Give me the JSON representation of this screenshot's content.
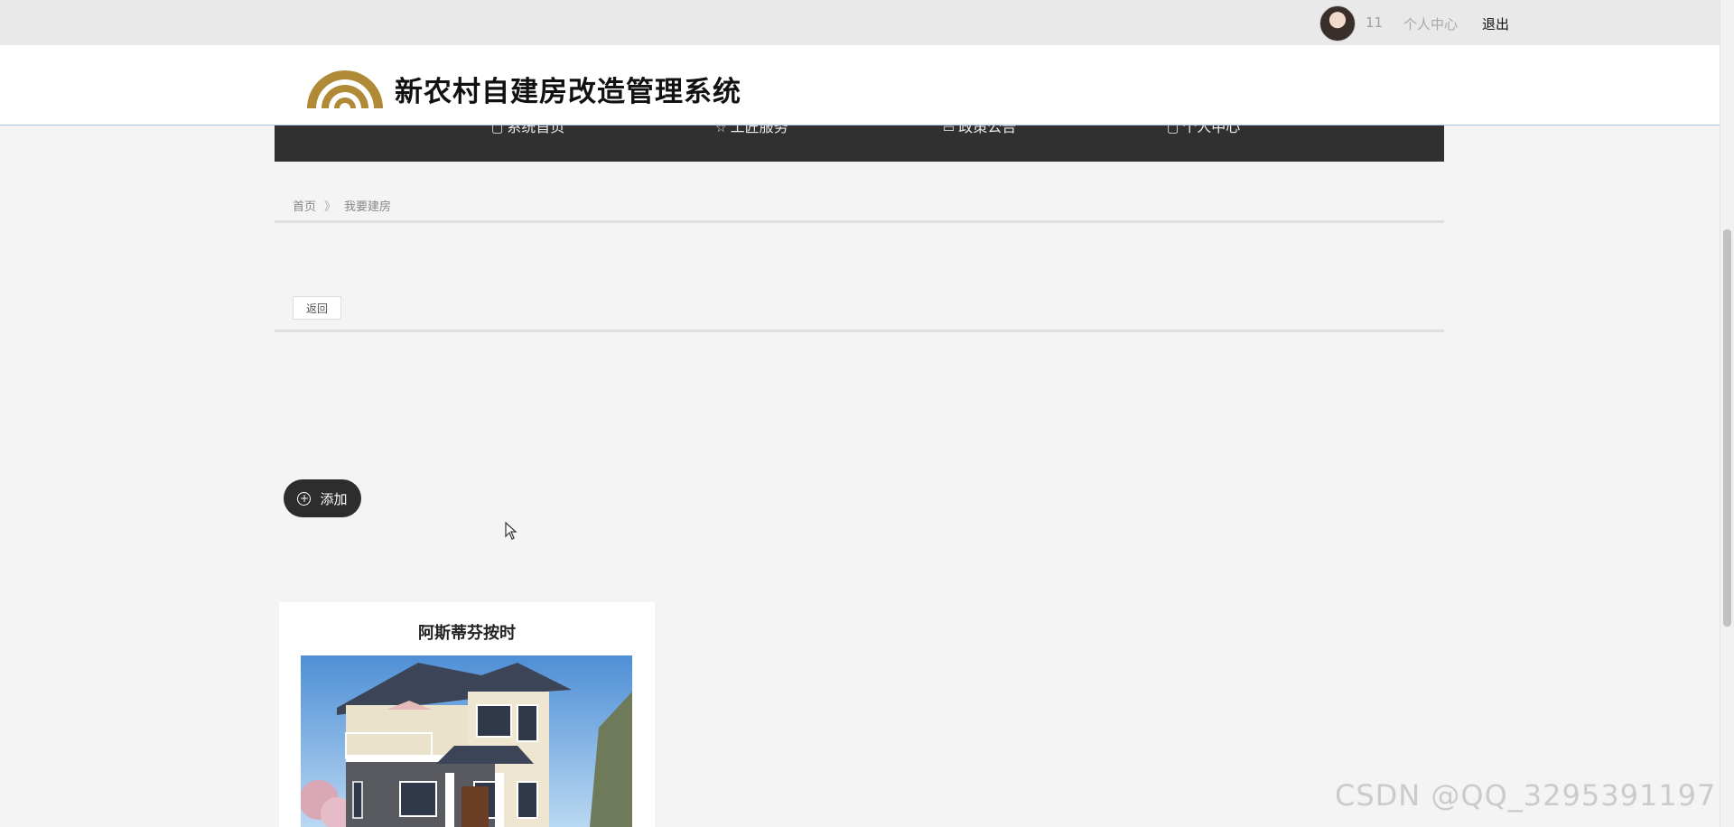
{
  "topbar": {
    "username": "11",
    "center_link": "个人中心",
    "logout_link": "退出"
  },
  "header": {
    "site_title": "新农村自建房改造管理系统"
  },
  "nav": {
    "items": [
      {
        "label": "系统首页",
        "icon": "home-icon"
      },
      {
        "label": "工匠服务",
        "icon": "star-icon"
      },
      {
        "label": "政策公告",
        "icon": "document-icon"
      },
      {
        "label": "个人中心",
        "icon": "user-icon"
      }
    ]
  },
  "breadcrumb": {
    "home": "首页",
    "separator": "》",
    "current": "我要建房"
  },
  "buttons": {
    "back": "返回",
    "add": "添加"
  },
  "cards": [
    {
      "title": "阿斯蒂芬按时"
    }
  ],
  "watermark": "CSDN @QQ_3295391197",
  "colors": {
    "navbar_bg": "#303030",
    "logo_gold": "#b08a36",
    "page_bg": "#f4f4f4"
  }
}
